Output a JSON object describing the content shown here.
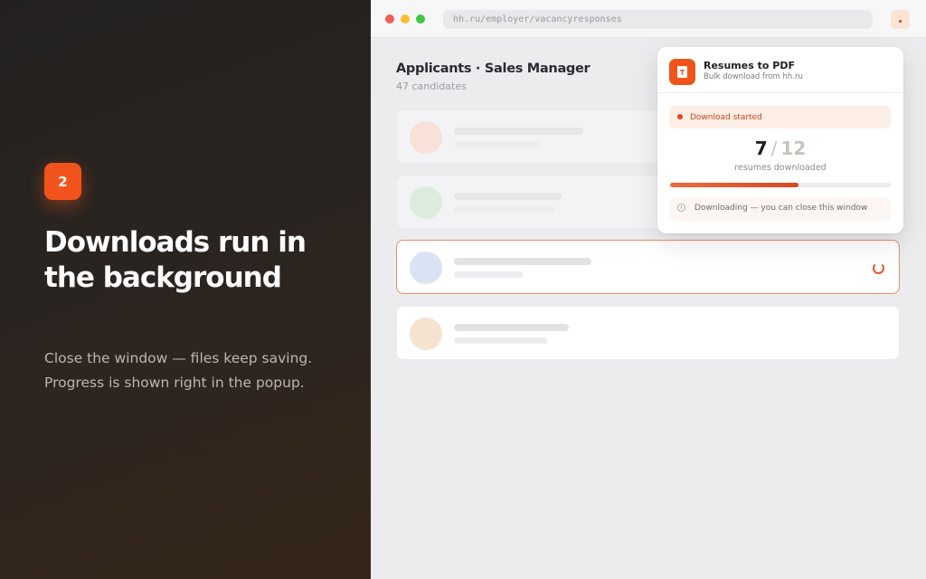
{
  "promo": {
    "step_number": "2",
    "headline": "Downloads run in the background",
    "subtext": "Close the window — files keep saving. Progress is shown right in the popup."
  },
  "browser": {
    "url": "hh.ru/employer/vacancyresponses",
    "extension_icon": "extension-icon"
  },
  "page": {
    "title": "Applicants · Sales Manager",
    "subtitle": "47 candidates",
    "cards": [
      {
        "avatar_color": "#f7e1d8",
        "state": "dim"
      },
      {
        "avatar_color": "#dcebdc",
        "state": "dim"
      },
      {
        "avatar_color": "#d9e3f4",
        "state": "active"
      },
      {
        "avatar_color": "#f6e3cf",
        "state": "normal"
      }
    ]
  },
  "popup": {
    "title": "Resumes to PDF",
    "subtitle": "Bulk download from hh.ru",
    "status": "Download started",
    "downloaded": "7",
    "total": "12",
    "count_label": "resumes downloaded",
    "progress": 0.58,
    "info": "Downloading — you can close this window"
  },
  "colors": {
    "accent": "#f0541c",
    "status_text": "#cc4519"
  }
}
